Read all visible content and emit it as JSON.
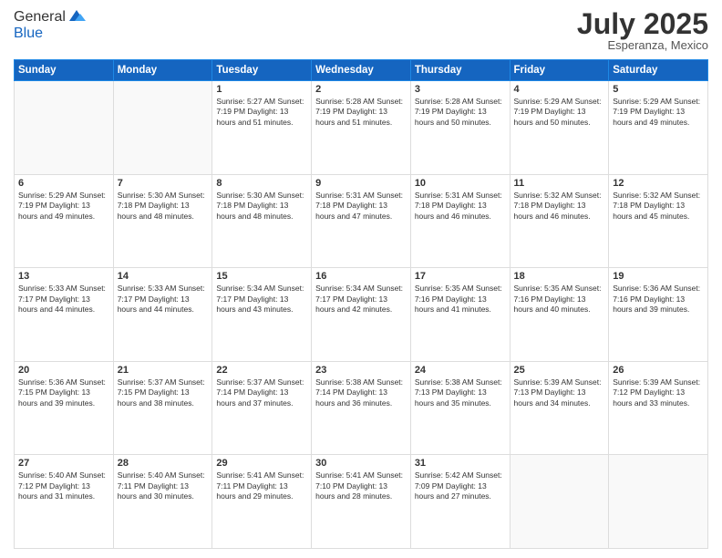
{
  "header": {
    "logo_line1": "General",
    "logo_line2": "Blue",
    "month": "July 2025",
    "location": "Esperanza, Mexico"
  },
  "days_of_week": [
    "Sunday",
    "Monday",
    "Tuesday",
    "Wednesday",
    "Thursday",
    "Friday",
    "Saturday"
  ],
  "weeks": [
    [
      {
        "day": "",
        "info": ""
      },
      {
        "day": "",
        "info": ""
      },
      {
        "day": "1",
        "info": "Sunrise: 5:27 AM\nSunset: 7:19 PM\nDaylight: 13 hours and 51 minutes."
      },
      {
        "day": "2",
        "info": "Sunrise: 5:28 AM\nSunset: 7:19 PM\nDaylight: 13 hours and 51 minutes."
      },
      {
        "day": "3",
        "info": "Sunrise: 5:28 AM\nSunset: 7:19 PM\nDaylight: 13 hours and 50 minutes."
      },
      {
        "day": "4",
        "info": "Sunrise: 5:29 AM\nSunset: 7:19 PM\nDaylight: 13 hours and 50 minutes."
      },
      {
        "day": "5",
        "info": "Sunrise: 5:29 AM\nSunset: 7:19 PM\nDaylight: 13 hours and 49 minutes."
      }
    ],
    [
      {
        "day": "6",
        "info": "Sunrise: 5:29 AM\nSunset: 7:19 PM\nDaylight: 13 hours and 49 minutes."
      },
      {
        "day": "7",
        "info": "Sunrise: 5:30 AM\nSunset: 7:18 PM\nDaylight: 13 hours and 48 minutes."
      },
      {
        "day": "8",
        "info": "Sunrise: 5:30 AM\nSunset: 7:18 PM\nDaylight: 13 hours and 48 minutes."
      },
      {
        "day": "9",
        "info": "Sunrise: 5:31 AM\nSunset: 7:18 PM\nDaylight: 13 hours and 47 minutes."
      },
      {
        "day": "10",
        "info": "Sunrise: 5:31 AM\nSunset: 7:18 PM\nDaylight: 13 hours and 46 minutes."
      },
      {
        "day": "11",
        "info": "Sunrise: 5:32 AM\nSunset: 7:18 PM\nDaylight: 13 hours and 46 minutes."
      },
      {
        "day": "12",
        "info": "Sunrise: 5:32 AM\nSunset: 7:18 PM\nDaylight: 13 hours and 45 minutes."
      }
    ],
    [
      {
        "day": "13",
        "info": "Sunrise: 5:33 AM\nSunset: 7:17 PM\nDaylight: 13 hours and 44 minutes."
      },
      {
        "day": "14",
        "info": "Sunrise: 5:33 AM\nSunset: 7:17 PM\nDaylight: 13 hours and 44 minutes."
      },
      {
        "day": "15",
        "info": "Sunrise: 5:34 AM\nSunset: 7:17 PM\nDaylight: 13 hours and 43 minutes."
      },
      {
        "day": "16",
        "info": "Sunrise: 5:34 AM\nSunset: 7:17 PM\nDaylight: 13 hours and 42 minutes."
      },
      {
        "day": "17",
        "info": "Sunrise: 5:35 AM\nSunset: 7:16 PM\nDaylight: 13 hours and 41 minutes."
      },
      {
        "day": "18",
        "info": "Sunrise: 5:35 AM\nSunset: 7:16 PM\nDaylight: 13 hours and 40 minutes."
      },
      {
        "day": "19",
        "info": "Sunrise: 5:36 AM\nSunset: 7:16 PM\nDaylight: 13 hours and 39 minutes."
      }
    ],
    [
      {
        "day": "20",
        "info": "Sunrise: 5:36 AM\nSunset: 7:15 PM\nDaylight: 13 hours and 39 minutes."
      },
      {
        "day": "21",
        "info": "Sunrise: 5:37 AM\nSunset: 7:15 PM\nDaylight: 13 hours and 38 minutes."
      },
      {
        "day": "22",
        "info": "Sunrise: 5:37 AM\nSunset: 7:14 PM\nDaylight: 13 hours and 37 minutes."
      },
      {
        "day": "23",
        "info": "Sunrise: 5:38 AM\nSunset: 7:14 PM\nDaylight: 13 hours and 36 minutes."
      },
      {
        "day": "24",
        "info": "Sunrise: 5:38 AM\nSunset: 7:13 PM\nDaylight: 13 hours and 35 minutes."
      },
      {
        "day": "25",
        "info": "Sunrise: 5:39 AM\nSunset: 7:13 PM\nDaylight: 13 hours and 34 minutes."
      },
      {
        "day": "26",
        "info": "Sunrise: 5:39 AM\nSunset: 7:12 PM\nDaylight: 13 hours and 33 minutes."
      }
    ],
    [
      {
        "day": "27",
        "info": "Sunrise: 5:40 AM\nSunset: 7:12 PM\nDaylight: 13 hours and 31 minutes."
      },
      {
        "day": "28",
        "info": "Sunrise: 5:40 AM\nSunset: 7:11 PM\nDaylight: 13 hours and 30 minutes."
      },
      {
        "day": "29",
        "info": "Sunrise: 5:41 AM\nSunset: 7:11 PM\nDaylight: 13 hours and 29 minutes."
      },
      {
        "day": "30",
        "info": "Sunrise: 5:41 AM\nSunset: 7:10 PM\nDaylight: 13 hours and 28 minutes."
      },
      {
        "day": "31",
        "info": "Sunrise: 5:42 AM\nSunset: 7:09 PM\nDaylight: 13 hours and 27 minutes."
      },
      {
        "day": "",
        "info": ""
      },
      {
        "day": "",
        "info": ""
      }
    ]
  ]
}
